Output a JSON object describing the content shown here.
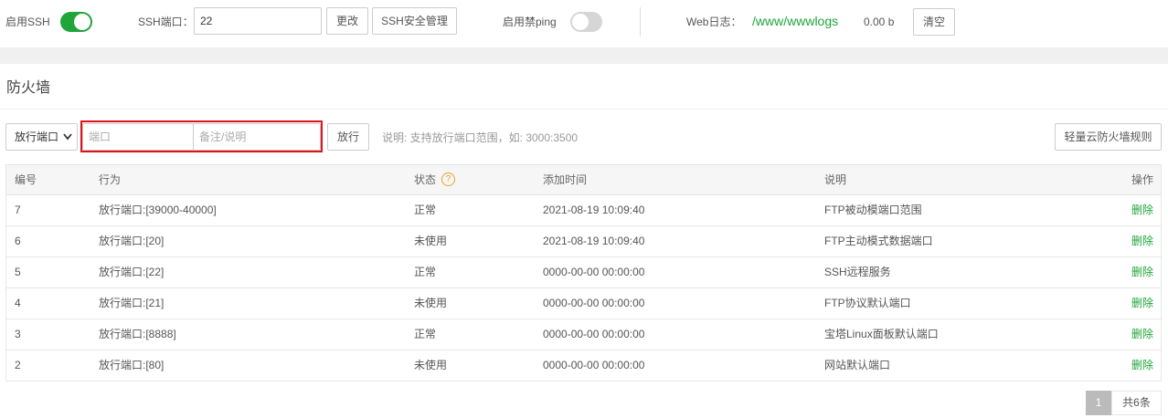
{
  "top": {
    "ssh_label": "启用SSH",
    "ssh_enabled": true,
    "ssh_port_label": "SSH端口：",
    "ssh_port_value": "22",
    "change_button": "更改",
    "ssh_manage_button": "SSH安全管理",
    "ping_label": "启用禁ping",
    "ping_enabled": false,
    "weblog_label": "Web日志：",
    "weblog_path": "/www/wwwlogs",
    "weblog_size": "0.00 b",
    "clear_button": "清空"
  },
  "firewall": {
    "title": "防火墙",
    "select_value": "放行端口",
    "port_placeholder": "端口",
    "note_placeholder": "备注/说明",
    "allow_button": "放行",
    "hint": "说明: 支持放行端口范围，如: 3000:3500",
    "cloud_rules_button": "轻量云防火墙规则"
  },
  "table": {
    "headers": [
      "编号",
      "行为",
      "状态",
      "添加时间",
      "说明",
      "操作"
    ],
    "help_icon": "?",
    "rows": [
      {
        "id": "7",
        "action": "放行端口:[39000-40000]",
        "status": "正常",
        "time": "2021-08-19 10:09:40",
        "note": "FTP被动模端口范围",
        "op": "删除"
      },
      {
        "id": "6",
        "action": "放行端口:[20]",
        "status": "未使用",
        "time": "2021-08-19 10:09:40",
        "note": "FTP主动模式数据端口",
        "op": "删除"
      },
      {
        "id": "5",
        "action": "放行端口:[22]",
        "status": "正常",
        "time": "0000-00-00 00:00:00",
        "note": "SSH远程服务",
        "op": "删除"
      },
      {
        "id": "4",
        "action": "放行端口:[21]",
        "status": "未使用",
        "time": "0000-00-00 00:00:00",
        "note": "FTP协议默认端口",
        "op": "删除"
      },
      {
        "id": "3",
        "action": "放行端口:[8888]",
        "status": "正常",
        "time": "0000-00-00 00:00:00",
        "note": "宝塔Linux面板默认端口",
        "op": "删除"
      },
      {
        "id": "2",
        "action": "放行端口:[80]",
        "status": "未使用",
        "time": "0000-00-00 00:00:00",
        "note": "网站默认端口",
        "op": "删除"
      }
    ]
  },
  "pager": {
    "current_page": "1",
    "total": "共6条"
  },
  "colors": {
    "accent_green": "#20a53a",
    "highlight_red": "#e0121a"
  }
}
